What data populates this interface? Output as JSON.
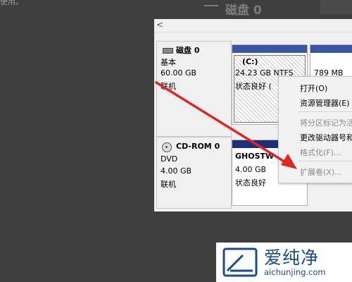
{
  "background": {
    "left_text": "使用。",
    "title_text": "磁盘 0"
  },
  "disks": [
    {
      "name": "磁盘 0",
      "type": "基本",
      "size": "60.00 GB",
      "status": "联机",
      "icon": "hard-disk-icon"
    },
    {
      "name": "CD-ROM 0",
      "type": "DVD",
      "size": "4.00 GB",
      "status": "联机",
      "icon": "cd-drive-icon"
    }
  ],
  "partitions": [
    {
      "label": "(C:)",
      "size": "24.23 GB NTFS",
      "status": "状态良好 (",
      "color": "#3a55a5"
    },
    {
      "label": "",
      "size": "789 MB",
      "status": "",
      "color": "#3a55a5"
    },
    {
      "label": "GHOSTW",
      "size": "4.00 GB",
      "status": "状态良好",
      "color": "#1e2f7a"
    }
  ],
  "context_menu": {
    "items": [
      {
        "label": "打开(O)",
        "enabled": true
      },
      {
        "label": "资源管理器(E)",
        "enabled": true
      },
      {
        "label": "将分区标记为活",
        "enabled": false
      },
      {
        "label": "更改驱动器号和",
        "enabled": true
      },
      {
        "label": "格式化(F)...",
        "enabled": false
      },
      {
        "label": "扩展卷(X)...",
        "enabled": false
      }
    ]
  },
  "annotation": {
    "arrow_color": "#e0271f"
  },
  "watermark": {
    "brand_cn": "爱纯净",
    "url": "aichunjing.com",
    "color": "#1b4a8f"
  }
}
